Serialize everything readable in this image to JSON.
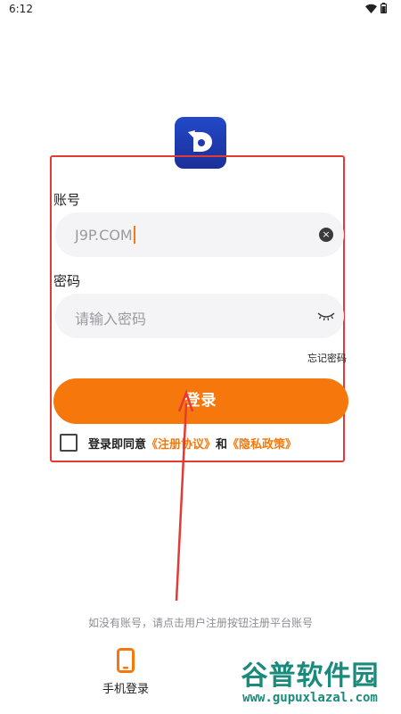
{
  "status_bar": {
    "time": "6:12"
  },
  "form": {
    "account_label": "账号",
    "account_value": "J9P.COM",
    "password_label": "密码",
    "password_placeholder": "请输入密码",
    "forgot_password": "忘记密码",
    "login_button": "登录",
    "agreement": {
      "prefix": "登录即同意",
      "terms_link": "《注册协议》",
      "and": "和",
      "privacy_link": "《隐私政策》"
    }
  },
  "register_hint": "如没有账号，请点击用户注册按钮注册平台账号",
  "bottom_options": [
    {
      "label": "手机登录",
      "icon": "phone-icon"
    }
  ],
  "watermark": {
    "title": "谷普软件园",
    "url": "www.gupuxlazal.com"
  },
  "colors": {
    "accent": "#f6780c",
    "logo_blue": "#2249c9",
    "annotation_red": "#e53935",
    "input_bg": "#f4f4f6"
  }
}
